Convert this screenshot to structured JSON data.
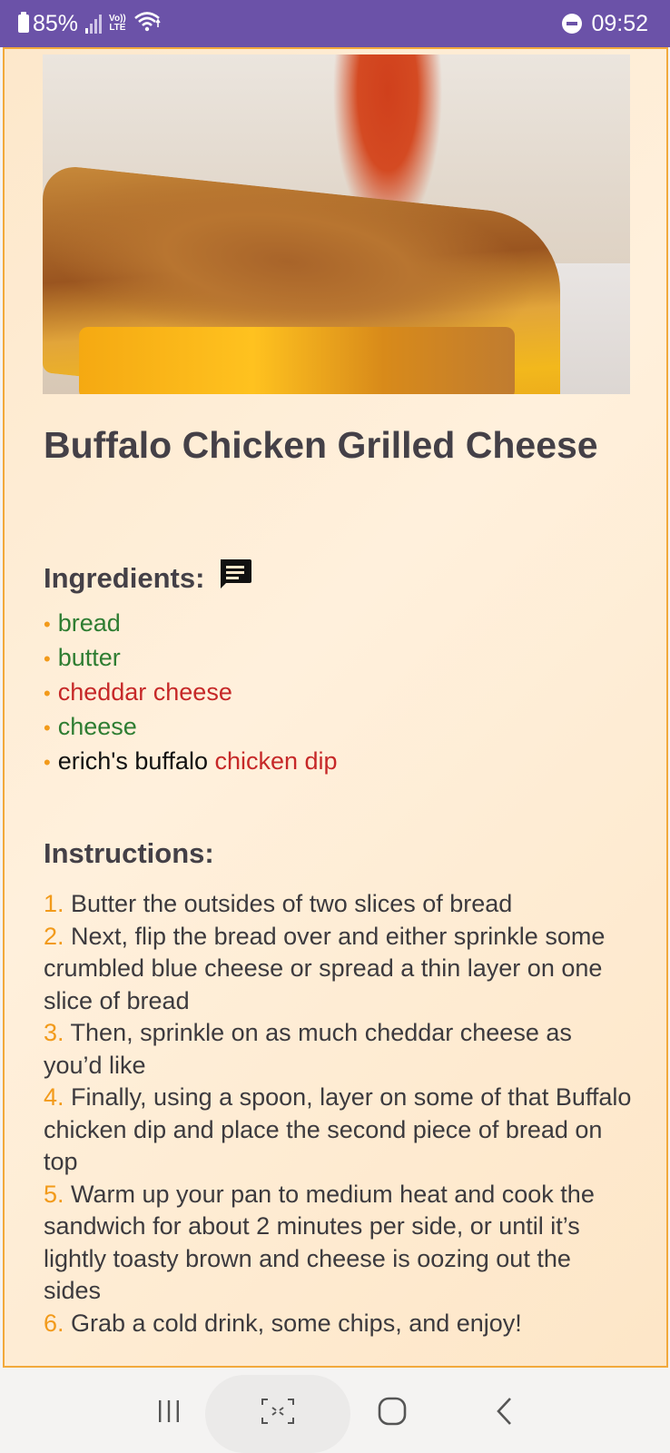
{
  "status_bar": {
    "battery_percent": "85%",
    "volte_label": "Vo)) LTE",
    "time": "09:52",
    "colors": {
      "background": "#6b52a8",
      "text": "#ffffff"
    }
  },
  "recipe": {
    "title": "Buffalo Chicken Grilled Cheese",
    "ingredients_heading": "Ingredients:",
    "ingredients": [
      {
        "parts": [
          {
            "text": "bread",
            "color": "green"
          }
        ]
      },
      {
        "parts": [
          {
            "text": "butter",
            "color": "green"
          }
        ]
      },
      {
        "parts": [
          {
            "text": "cheddar cheese",
            "color": "red"
          }
        ]
      },
      {
        "parts": [
          {
            "text": "cheese",
            "color": "green"
          }
        ]
      },
      {
        "parts": [
          {
            "text": "erich's buffalo ",
            "color": "black"
          },
          {
            "text": "chicken dip",
            "color": "red"
          }
        ]
      }
    ],
    "instructions_heading": "Instructions:",
    "steps": [
      {
        "num": "1.",
        "text": " Butter the outsides of two slices of bread"
      },
      {
        "num": "2.",
        "text": " Next, flip the bread over and either sprinkle some crumbled blue cheese or spread a thin layer on one slice of bread"
      },
      {
        "num": "3.",
        "text": " Then, sprinkle on as much cheddar cheese as you’d like"
      },
      {
        "num": "4.",
        "text": " Finally, using a spoon, layer on some of that Buffalo chicken dip and place the second piece of bread on top"
      },
      {
        "num": "5.",
        "text": " Warm up your pan to medium heat and cook the sandwich for about 2 minutes per side, or until it’s lightly toasty brown and cheese is oozing out the sides"
      },
      {
        "num": "6.",
        "text": " Grab a cold drink, some chips, and enjoy!"
      }
    ]
  },
  "icons": {
    "comment": "comment-icon",
    "recents": "recents-icon",
    "screenshot": "screen-capture-icon",
    "home": "home-icon",
    "back": "back-icon"
  },
  "colors": {
    "accent": "#f29a1a",
    "ingredient_green": "#2e7d32",
    "ingredient_red": "#c62828",
    "frame_border": "#f2a93b"
  }
}
